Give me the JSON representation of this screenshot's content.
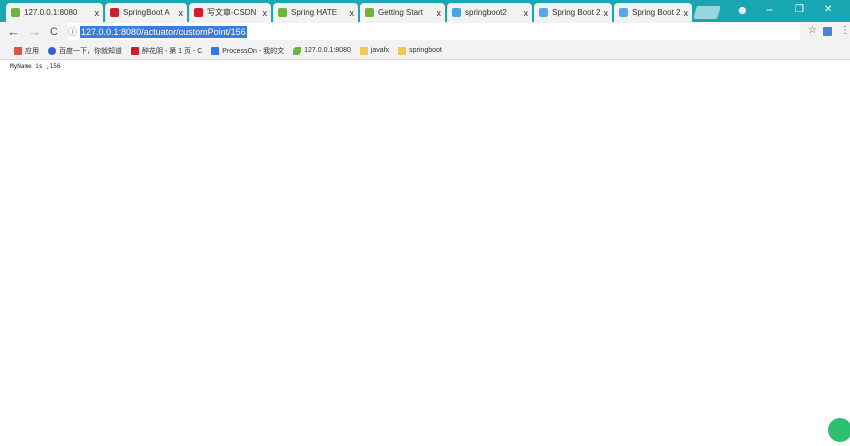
{
  "tabs": [
    {
      "title": "127.0.0.1:8080",
      "icon": "leaf-icon",
      "active": true
    },
    {
      "title": "SpringBoot A",
      "icon": "csdn-icon"
    },
    {
      "title": "写文章-CSDN",
      "icon": "csdn-icon"
    },
    {
      "title": "Spring HATE",
      "icon": "spring-icon"
    },
    {
      "title": "Getting Start",
      "icon": "spring-icon"
    },
    {
      "title": "springboot2",
      "icon": "springboot-icon"
    },
    {
      "title": "Spring Boot 2",
      "icon": "cloud-icon"
    },
    {
      "title": "Spring Boot 2",
      "icon": "cloud-icon"
    }
  ],
  "tab_close": "x",
  "window_controls": {
    "profile": "☻",
    "minimize": "−",
    "maximize": "❐",
    "close": "✕"
  },
  "toolbar": {
    "back": "←",
    "forward": "→",
    "reload": "C",
    "info": "ⓘ",
    "url": "127.0.0.1:8080/actuator/customPoint/156",
    "star": "☆",
    "ext_label": "ext",
    "menu": "⋮"
  },
  "bookmarks": [
    {
      "label": "应用",
      "icon": "apps-icon",
      "color": "#e0533e"
    },
    {
      "label": "百度一下，你就知道",
      "icon": "baidu-icon",
      "color": "#2d62d6"
    },
    {
      "label": "醉花阴 - 第 1 页 - C",
      "icon": "csdn-icon",
      "color": "#c9202b"
    },
    {
      "label": "ProcessOn - 我的文",
      "icon": "processon-icon",
      "color": "#2d7be0"
    },
    {
      "label": "127.0.0.1:8080",
      "icon": "leaf-icon",
      "color": "#6db33f"
    },
    {
      "label": "javafx",
      "icon": "folder-icon",
      "color": "#f3c94b"
    },
    {
      "label": "springboot",
      "icon": "folder-icon",
      "color": "#f3c94b"
    }
  ],
  "page": {
    "text": "MyName is ,156"
  },
  "colors": {
    "tabbar": "#1aa7b4",
    "url_selection": "#3b7ddd",
    "fab": "#2fbf71"
  }
}
